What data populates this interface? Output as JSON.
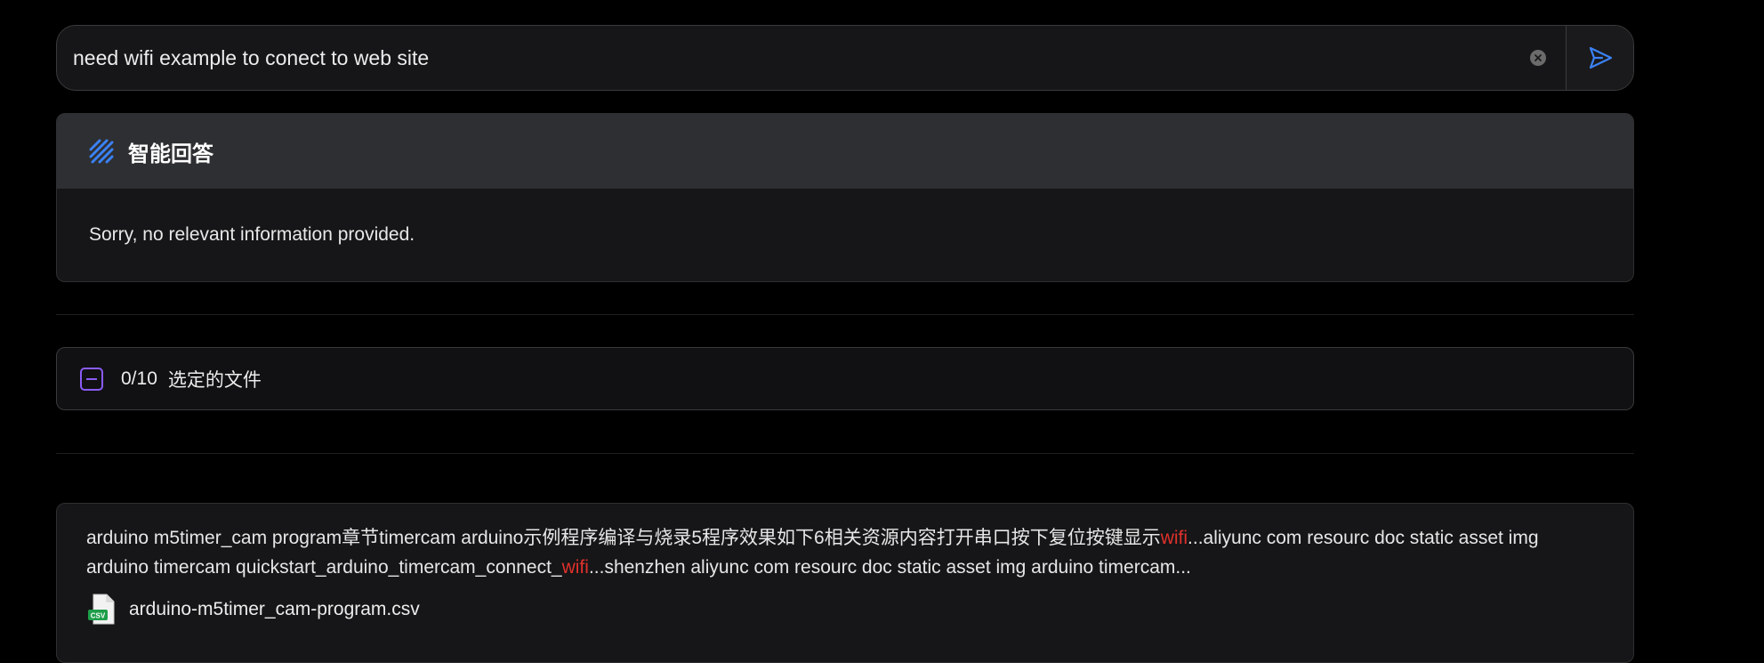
{
  "search": {
    "query": "need wifi example to conect to web site"
  },
  "answer": {
    "title": "智能回答",
    "body": "Sorry, no relevant information provided."
  },
  "selection": {
    "count": "0/10",
    "label": "选定的文件"
  },
  "results": [
    {
      "snippet_parts": [
        {
          "text": "arduino m5timer_cam program章节timercam arduino示例程序编译与烧录5程序效果如下6相关资源内容打开串口按下复位按键显示",
          "highlight": false
        },
        {
          "text": "wifi",
          "highlight": true
        },
        {
          "text": "...aliyunc com resourc doc static asset img arduino timercam quickstart_arduino_timercam_connect_",
          "highlight": false
        },
        {
          "text": "wifi",
          "highlight": true
        },
        {
          "text": "...shenzhen aliyunc com resourc doc static asset img arduino timercam...",
          "highlight": false
        }
      ],
      "file_name": "arduino-m5timer_cam-program.csv",
      "file_icon_label": "CSV"
    }
  ],
  "colors": {
    "accent_blue": "#3b82f6",
    "accent_purple": "#8a5cf5",
    "highlight_red": "#e0312b",
    "csv_green": "#1e9e4a"
  },
  "icons": {
    "answer": "ai-stripes-icon",
    "send": "send-icon",
    "clear": "clear-icon",
    "file": "csv-file-icon"
  }
}
